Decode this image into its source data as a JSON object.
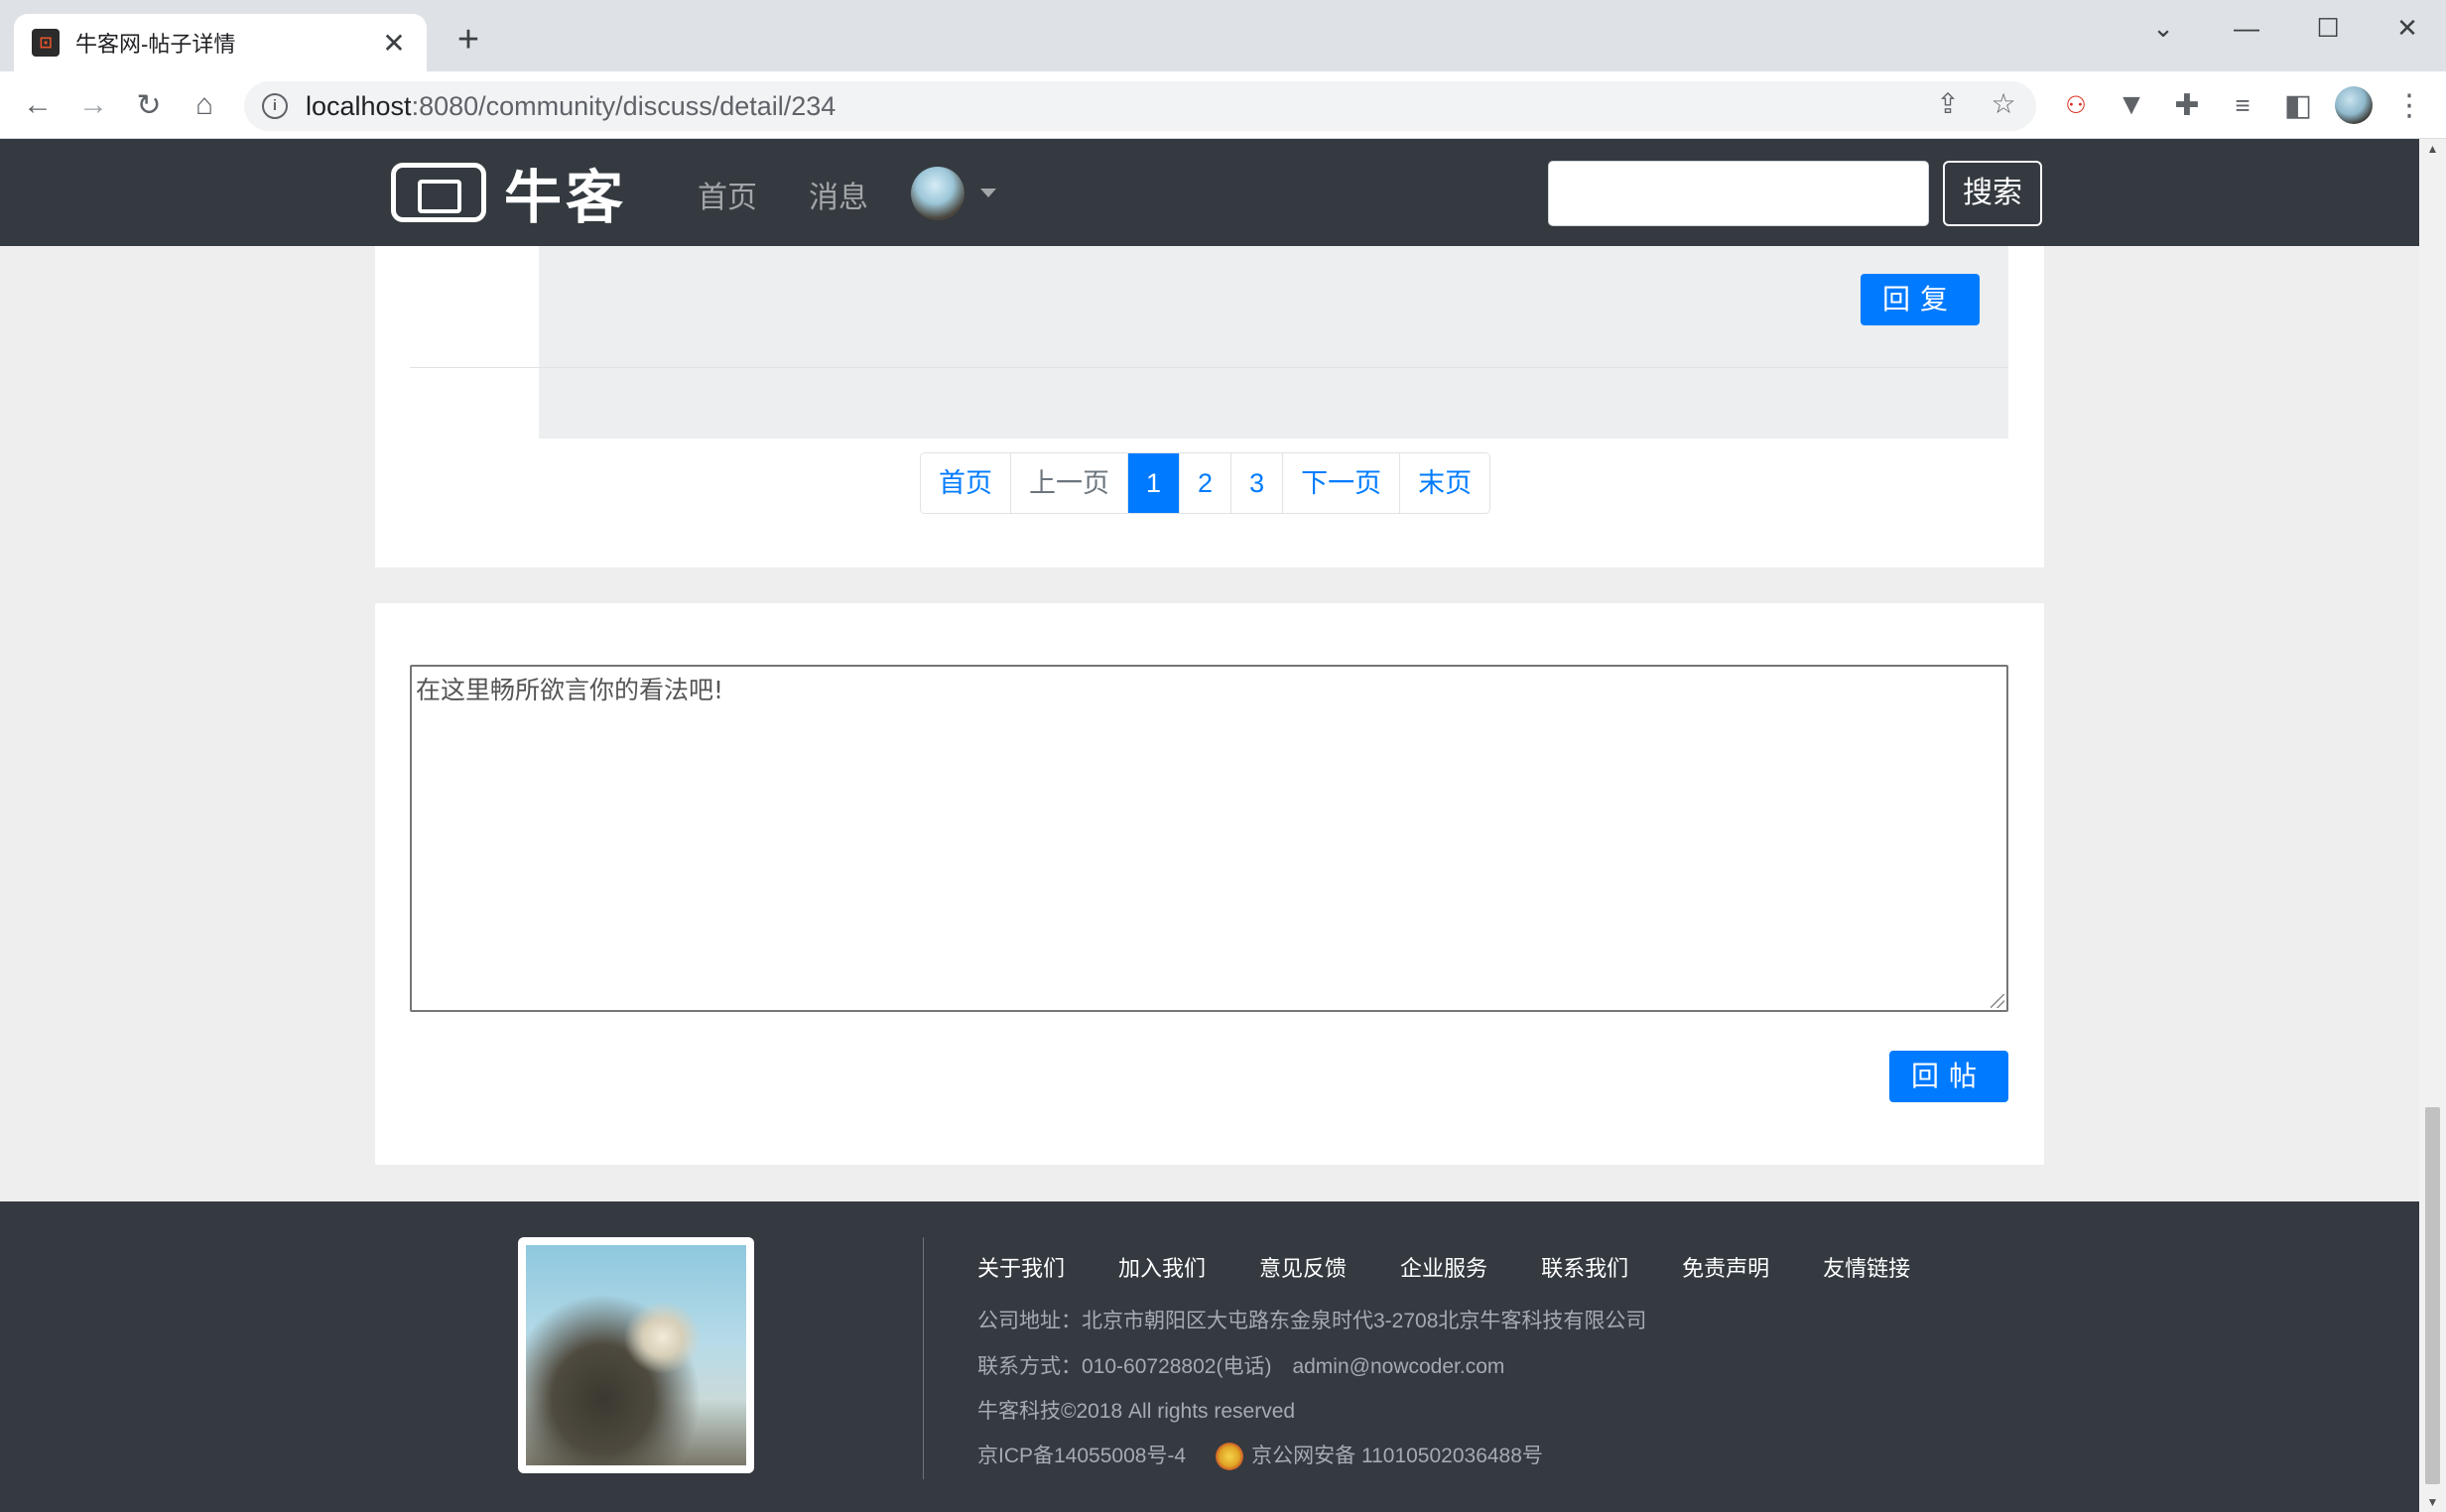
{
  "browser": {
    "tab_title": "牛客网-帖子详情",
    "tab_close": "✕",
    "new_tab": "+",
    "url_host": "localhost",
    "url_path": ":8080/community/discuss/detail/234"
  },
  "navbar": {
    "logo_text": "牛客",
    "links": [
      "首页",
      "消息"
    ],
    "search_placeholder": "",
    "search_button": "搜索"
  },
  "reply_section": {
    "reply_button": "回复"
  },
  "pagination": {
    "items": [
      "首页",
      "上一页",
      "1",
      "2",
      "3",
      "下一页",
      "末页"
    ],
    "active": "1"
  },
  "comment_form": {
    "textarea_value": "在这里畅所欲言你的看法吧!",
    "submit_button": "回帖"
  },
  "footer": {
    "links": [
      "关于我们",
      "加入我们",
      "意见反馈",
      "企业服务",
      "联系我们",
      "免责声明",
      "友情链接"
    ],
    "address": "公司地址：北京市朝阳区大屯路东金泉时代3-2708北京牛客科技有限公司",
    "contact": "联系方式：010-60728802(电话)　admin@nowcoder.com",
    "copyright": "牛客科技©2018 All rights reserved",
    "icp": "京ICP备14055008号-4",
    "police": "京公网安备 11010502036488号"
  },
  "colors": {
    "primary": "#007bff",
    "navbar": "#343a40",
    "footer": "#343a40",
    "page_bg": "#eeeeee"
  }
}
